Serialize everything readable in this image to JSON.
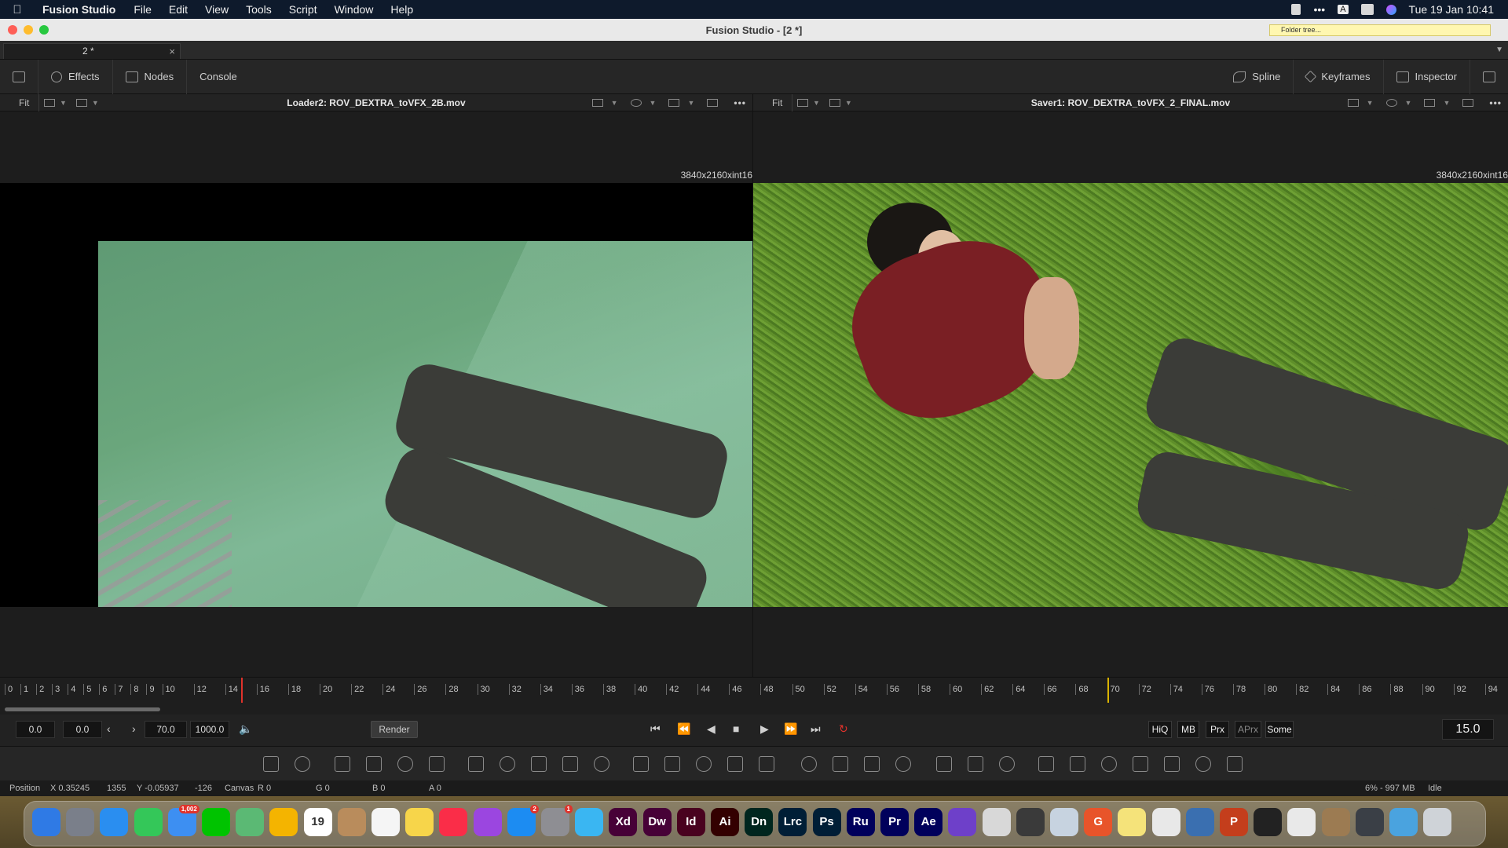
{
  "menubar": {
    "app": "Fusion Studio",
    "items": [
      "File",
      "Edit",
      "View",
      "Tools",
      "Script",
      "Window",
      "Help"
    ],
    "clock": "Tue 19 Jan  10:41",
    "input_source": "A"
  },
  "window": {
    "title": "Fusion Studio - [2 *]",
    "folder_tree": "Folder tree..."
  },
  "doc_tab": {
    "label": "2 *",
    "close": "×"
  },
  "toolbar": {
    "effects": "Effects",
    "nodes": "Nodes",
    "console": "Console",
    "spline": "Spline",
    "keyframes": "Keyframes",
    "inspector": "Inspector"
  },
  "viewer_left": {
    "fit": "Fit",
    "title": "Loader2: ROV_DEXTRA_toVFX_2B.mov",
    "resolution": "3840x2160xint16"
  },
  "viewer_right": {
    "fit": "Fit",
    "title": "Saver1: ROV_DEXTRA_toVFX_2_FINAL.mov",
    "resolution": "3840x2160xint16"
  },
  "timeline": {
    "ticks": [
      "0",
      "1",
      "2",
      "3",
      "4",
      "5",
      "6",
      "7",
      "8",
      "9",
      "10",
      "12",
      "14",
      "16",
      "18",
      "20",
      "22",
      "24",
      "26",
      "28",
      "30",
      "32",
      "34",
      "36",
      "38",
      "40",
      "42",
      "44",
      "46",
      "48",
      "50",
      "52",
      "54",
      "56",
      "58",
      "60",
      "62",
      "64",
      "66",
      "68",
      "70",
      "72",
      "74",
      "76",
      "78",
      "80",
      "82",
      "84",
      "86",
      "88",
      "90",
      "92",
      "94"
    ],
    "current_frame": 15,
    "render_end": 70,
    "playhead_color": "#e0322b",
    "end_marker_color": "#d9b300"
  },
  "transport": {
    "global_start": "0.0",
    "render_start": "0.0",
    "render_end": "70.0",
    "global_end": "1000.0",
    "render_label": "Render",
    "quality_buttons": [
      "HiQ",
      "MB",
      "Prx",
      "APrx",
      "Some"
    ],
    "current_time": "15.0"
  },
  "status": {
    "position_label": "Position",
    "x": "X 0.35245",
    "px": "1355",
    "y": "Y -0.05937",
    "py": "-126",
    "canvas": "Canvas",
    "r": "R 0",
    "g": "G 0",
    "b": "B 0",
    "a": "A 0",
    "memory": "6% - 997 MB",
    "state": "Idle"
  },
  "dock": {
    "apps": [
      {
        "name": "Finder",
        "icon": "finder-icon",
        "color": "#2f7ae5",
        "label": ""
      },
      {
        "name": "Launchpad",
        "icon": "launchpad-icon",
        "color": "#7a7f8a",
        "label": ""
      },
      {
        "name": "Safari",
        "icon": "safari-icon",
        "color": "#2a8ef0",
        "label": ""
      },
      {
        "name": "Messages",
        "icon": "messages-icon",
        "color": "#34c759",
        "label": ""
      },
      {
        "name": "Mail",
        "icon": "mail-icon",
        "color": "#3d8ff2",
        "label": "",
        "badge": "1,002"
      },
      {
        "name": "LINE",
        "icon": "line-icon",
        "color": "#00c300",
        "label": ""
      },
      {
        "name": "Maps",
        "icon": "maps-icon",
        "color": "#5bb974",
        "label": ""
      },
      {
        "name": "Photos",
        "icon": "photos-icon",
        "color": "#f4b400",
        "label": ""
      },
      {
        "name": "Calendar",
        "icon": "calendar-icon",
        "color": "#ffffff",
        "label": "19"
      },
      {
        "name": "Contacts",
        "icon": "contacts-icon",
        "color": "#b98c5c",
        "label": ""
      },
      {
        "name": "Reminders",
        "icon": "reminders-icon",
        "color": "#f5f5f5",
        "label": ""
      },
      {
        "name": "Notes",
        "icon": "notes-icon",
        "color": "#f7d54a",
        "label": ""
      },
      {
        "name": "Music",
        "icon": "music-icon",
        "color": "#fa2d48",
        "label": ""
      },
      {
        "name": "Podcasts",
        "icon": "podcasts-icon",
        "color": "#9b46e0",
        "label": ""
      },
      {
        "name": "App Store",
        "icon": "appstore-icon",
        "color": "#1c8cf2",
        "label": "",
        "badge": "2"
      },
      {
        "name": "System Preferences",
        "icon": "preferences-icon",
        "color": "#8e8e93",
        "label": "",
        "badge": "1"
      },
      {
        "name": "Preview",
        "icon": "preview-icon",
        "color": "#3ab6f2",
        "label": ""
      },
      {
        "name": "Adobe XD",
        "icon": "xd-icon",
        "color": "#470137",
        "label": "Xd"
      },
      {
        "name": "Dreamweaver",
        "icon": "dw-icon",
        "color": "#470137",
        "label": "Dw"
      },
      {
        "name": "InDesign",
        "icon": "id-icon",
        "color": "#49021f",
        "label": "Id"
      },
      {
        "name": "Illustrator",
        "icon": "ai-icon",
        "color": "#330000",
        "label": "Ai"
      },
      {
        "name": "Dimension",
        "icon": "dn-icon",
        "color": "#00261e",
        "label": "Dn"
      },
      {
        "name": "Lightroom Classic",
        "icon": "lrc-icon",
        "color": "#001e36",
        "label": "Lrc"
      },
      {
        "name": "Photoshop",
        "icon": "ps-icon",
        "color": "#001e36",
        "label": "Ps"
      },
      {
        "name": "Premiere Rush",
        "icon": "ru-icon",
        "color": "#00005b",
        "label": "Ru"
      },
      {
        "name": "Premiere Pro",
        "icon": "pr-icon",
        "color": "#00005b",
        "label": "Pr"
      },
      {
        "name": "After Effects",
        "icon": "ae-icon",
        "color": "#00005b",
        "label": "Ae"
      },
      {
        "name": "GitHub Desktop",
        "icon": "github-icon",
        "color": "#6e40c9",
        "label": ""
      },
      {
        "name": "Xcode Labs",
        "icon": "flask-icon",
        "color": "#d8d8d8",
        "label": ""
      },
      {
        "name": "Sublime Text",
        "icon": "sublime-icon",
        "color": "#3a3a3a",
        "label": ""
      },
      {
        "name": "Screen",
        "icon": "screen-icon",
        "color": "#c7d3e0",
        "label": ""
      },
      {
        "name": "Grammarly",
        "icon": "grammarly-icon",
        "color": "#e8542a",
        "label": "G"
      },
      {
        "name": "Stickies",
        "icon": "stickies-icon",
        "color": "#f5e37a",
        "label": ""
      },
      {
        "name": "Chrome",
        "icon": "chrome-icon",
        "color": "#e8e8e8",
        "label": ""
      },
      {
        "name": "QuickTime",
        "icon": "quicktime-icon",
        "color": "#3a6fb0",
        "label": ""
      },
      {
        "name": "PowerPoint",
        "icon": "powerpoint-icon",
        "color": "#c43e1c",
        "label": "P"
      },
      {
        "name": "Fusion",
        "icon": "fusion-icon",
        "color": "#222222",
        "label": ""
      },
      {
        "name": "Archive",
        "icon": "archive-icon",
        "color": "#e9e9e9",
        "label": ""
      },
      {
        "name": "Images Folder",
        "icon": "images-folder-icon",
        "color": "#9c7b52",
        "label": ""
      },
      {
        "name": "Terminal Folder",
        "icon": "terminal-folder-icon",
        "color": "#3a3f46",
        "label": ""
      },
      {
        "name": "Downloads",
        "icon": "folder-icon",
        "color": "#4aa3df",
        "label": ""
      },
      {
        "name": "Trash",
        "icon": "trash-icon",
        "color": "#cfd3d8",
        "label": ""
      }
    ]
  }
}
